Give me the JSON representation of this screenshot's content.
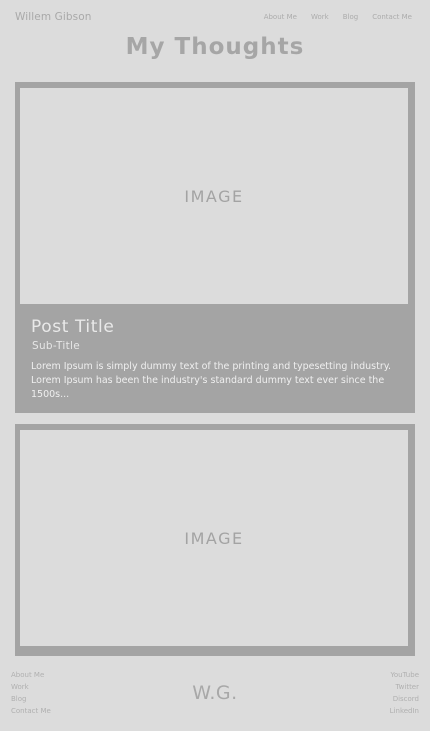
{
  "header": {
    "site_name": "Willem Gibson",
    "nav": [
      "About Me",
      "Work",
      "Blog",
      "Contact Me"
    ]
  },
  "page_title": "My Thoughts",
  "posts": [
    {
      "image_label": "IMAGE",
      "title": "Post Title",
      "subtitle": "Sub-Title",
      "excerpt": "Lorem Ipsum is simply dummy text of the printing and typesetting industry. Lorem Ipsum has been the industry's standard dummy text ever since the 1500s..."
    },
    {
      "image_label": "IMAGE"
    }
  ],
  "footer": {
    "left_links": [
      "About Me",
      "Work",
      "Blog",
      "Contact Me"
    ],
    "logo": "W.G.",
    "right_links": [
      "YouTube",
      "Twitter",
      "Discord",
      "LinkedIn"
    ]
  },
  "colors": {
    "background": "#dcdcdc",
    "card": "#a4a4a4",
    "text_muted": "#a3a3a3",
    "text_light": "#e9e9e9"
  }
}
